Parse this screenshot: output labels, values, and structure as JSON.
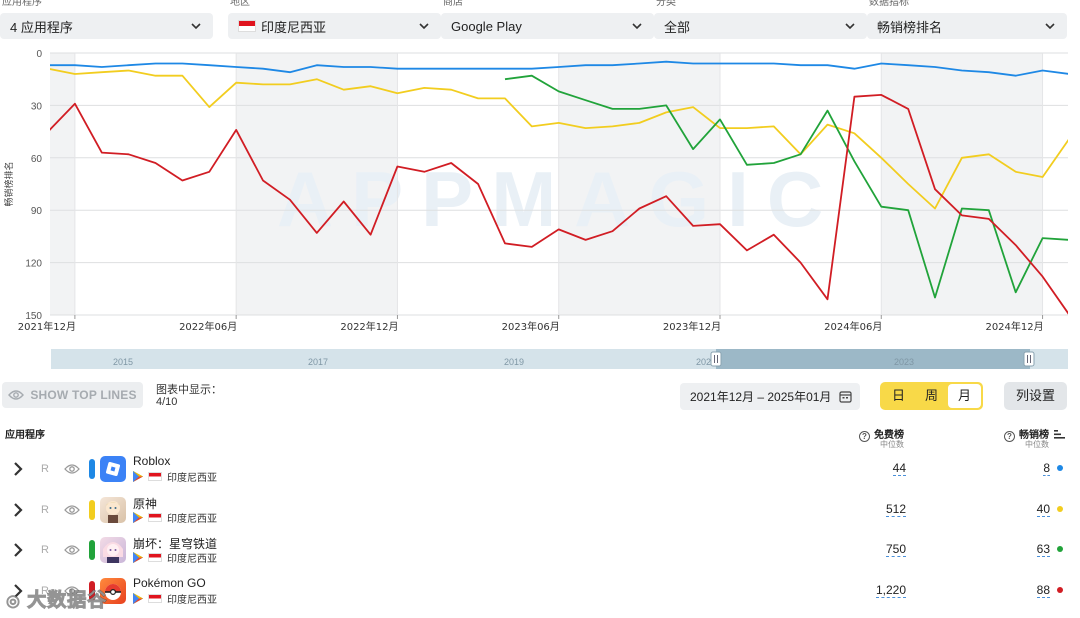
{
  "filters": [
    {
      "label": "应用程序",
      "value": "4 应用程序",
      "flag": false
    },
    {
      "label": "地区",
      "value": "印度尼西亚",
      "flag": true
    },
    {
      "label": "商店",
      "value": "Google Play",
      "flag": false
    },
    {
      "label": "分类",
      "value": "全部",
      "flag": false
    },
    {
      "label": "数据指标",
      "value": "畅销榜排名",
      "flag": false
    }
  ],
  "chart_data": {
    "type": "line",
    "ylabel": "畅销榜排名",
    "y_inverted": true,
    "ylim": [
      0,
      150
    ],
    "yticks": [
      0,
      30,
      60,
      90,
      120,
      150
    ],
    "grid": true,
    "watermark": "APPMAGIC",
    "x": [
      "2021-11",
      "2021-12",
      "2022-01",
      "2022-02",
      "2022-03",
      "2022-04",
      "2022-05",
      "2022-06",
      "2022-07",
      "2022-08",
      "2022-09",
      "2022-10",
      "2022-11",
      "2022-12",
      "2023-01",
      "2023-02",
      "2023-03",
      "2023-04",
      "2023-05",
      "2023-06",
      "2023-07",
      "2023-08",
      "2023-09",
      "2023-10",
      "2023-11",
      "2023-12",
      "2024-01",
      "2024-02",
      "2024-03",
      "2024-04",
      "2024-05",
      "2024-06",
      "2024-07",
      "2024-08",
      "2024-09",
      "2024-10",
      "2024-11",
      "2024-12",
      "2025-01"
    ],
    "xtick_labels": [
      {
        "x": "2021-12",
        "label": "2021年12月"
      },
      {
        "x": "2022-06",
        "label": "2022年06月"
      },
      {
        "x": "2022-12",
        "label": "2022年12月"
      },
      {
        "x": "2023-06",
        "label": "2023年06月"
      },
      {
        "x": "2023-12",
        "label": "2023年12月"
      },
      {
        "x": "2024-06",
        "label": "2024年06月"
      },
      {
        "x": "2024-12",
        "label": "2024年12月"
      }
    ],
    "series": [
      {
        "name": "Roblox",
        "color": "#1e88e5",
        "values": [
          7,
          7,
          8,
          7,
          6,
          6,
          7,
          8,
          9,
          11,
          7,
          8,
          8,
          9,
          9,
          9,
          9,
          9,
          9,
          8,
          7,
          7,
          6,
          5,
          6,
          6,
          6,
          6,
          7,
          7,
          9,
          6,
          7,
          8,
          10,
          11,
          13,
          10,
          12
        ]
      },
      {
        "name": "原神",
        "color": "#f2cd1f",
        "values": [
          9,
          12,
          11,
          10,
          13,
          13,
          31,
          17,
          18,
          18,
          15,
          21,
          19,
          23,
          20,
          21,
          26,
          26,
          42,
          40,
          43,
          42,
          40,
          34,
          31,
          43,
          43,
          42,
          58,
          41,
          46,
          60,
          75,
          89,
          60,
          58,
          68,
          71,
          49
        ]
      },
      {
        "name": "崩坏：星穹铁道",
        "color": "#21a33a",
        "values": [
          null,
          null,
          null,
          null,
          null,
          null,
          null,
          null,
          null,
          null,
          null,
          null,
          null,
          null,
          null,
          null,
          null,
          15,
          13,
          22,
          27,
          32,
          32,
          30,
          55,
          38,
          64,
          63,
          58,
          33,
          62,
          88,
          90,
          140,
          89,
          90,
          137,
          106,
          107
        ]
      },
      {
        "name": "Pokémon GO",
        "color": "#d11d24",
        "values": [
          45,
          29,
          57,
          58,
          63,
          73,
          68,
          44,
          73,
          84,
          103,
          85,
          104,
          65,
          68,
          63,
          75,
          109,
          111,
          101,
          107,
          102,
          89,
          82,
          99,
          98,
          113,
          104,
          120,
          141,
          25,
          24,
          32,
          78,
          93,
          95,
          110,
          128,
          150
        ]
      }
    ]
  },
  "navigator": {
    "years": [
      "2015",
      "2017",
      "2019",
      "2021",
      "2023"
    ]
  },
  "controls": {
    "show_top_lines": "SHOW TOP LINES",
    "chart_shown_label": "图表中显示：",
    "chart_shown_value": "4/10",
    "date_range": "2021年12月 – 2025年01月",
    "periods": [
      "日",
      "周",
      "月"
    ],
    "active_period": "月",
    "columns_button": "列设置"
  },
  "table": {
    "col_app": "应用程序",
    "col_free": "免费榜",
    "col_free_sub": "中位数",
    "col_grossing": "畅销榜",
    "col_grossing_sub": "中位数",
    "rows": [
      {
        "name": "Roblox",
        "region": "印度尼西亚",
        "r": "R",
        "color": "#1e88e5",
        "free": "44",
        "grossing": "8"
      },
      {
        "name": "原神",
        "region": "印度尼西亚",
        "r": "R",
        "color": "#f2cd1f",
        "free": "512",
        "grossing": "40"
      },
      {
        "name": "崩坏：星穹铁道",
        "region": "印度尼西亚",
        "r": "R",
        "color": "#21a33a",
        "free": "750",
        "grossing": "63"
      },
      {
        "name": "Pokémon GO",
        "region": "印度尼西亚",
        "r": "R",
        "color": "#d11d24",
        "free": "1,220",
        "grossing": "88"
      }
    ]
  },
  "corner_watermark": "大数据谷"
}
